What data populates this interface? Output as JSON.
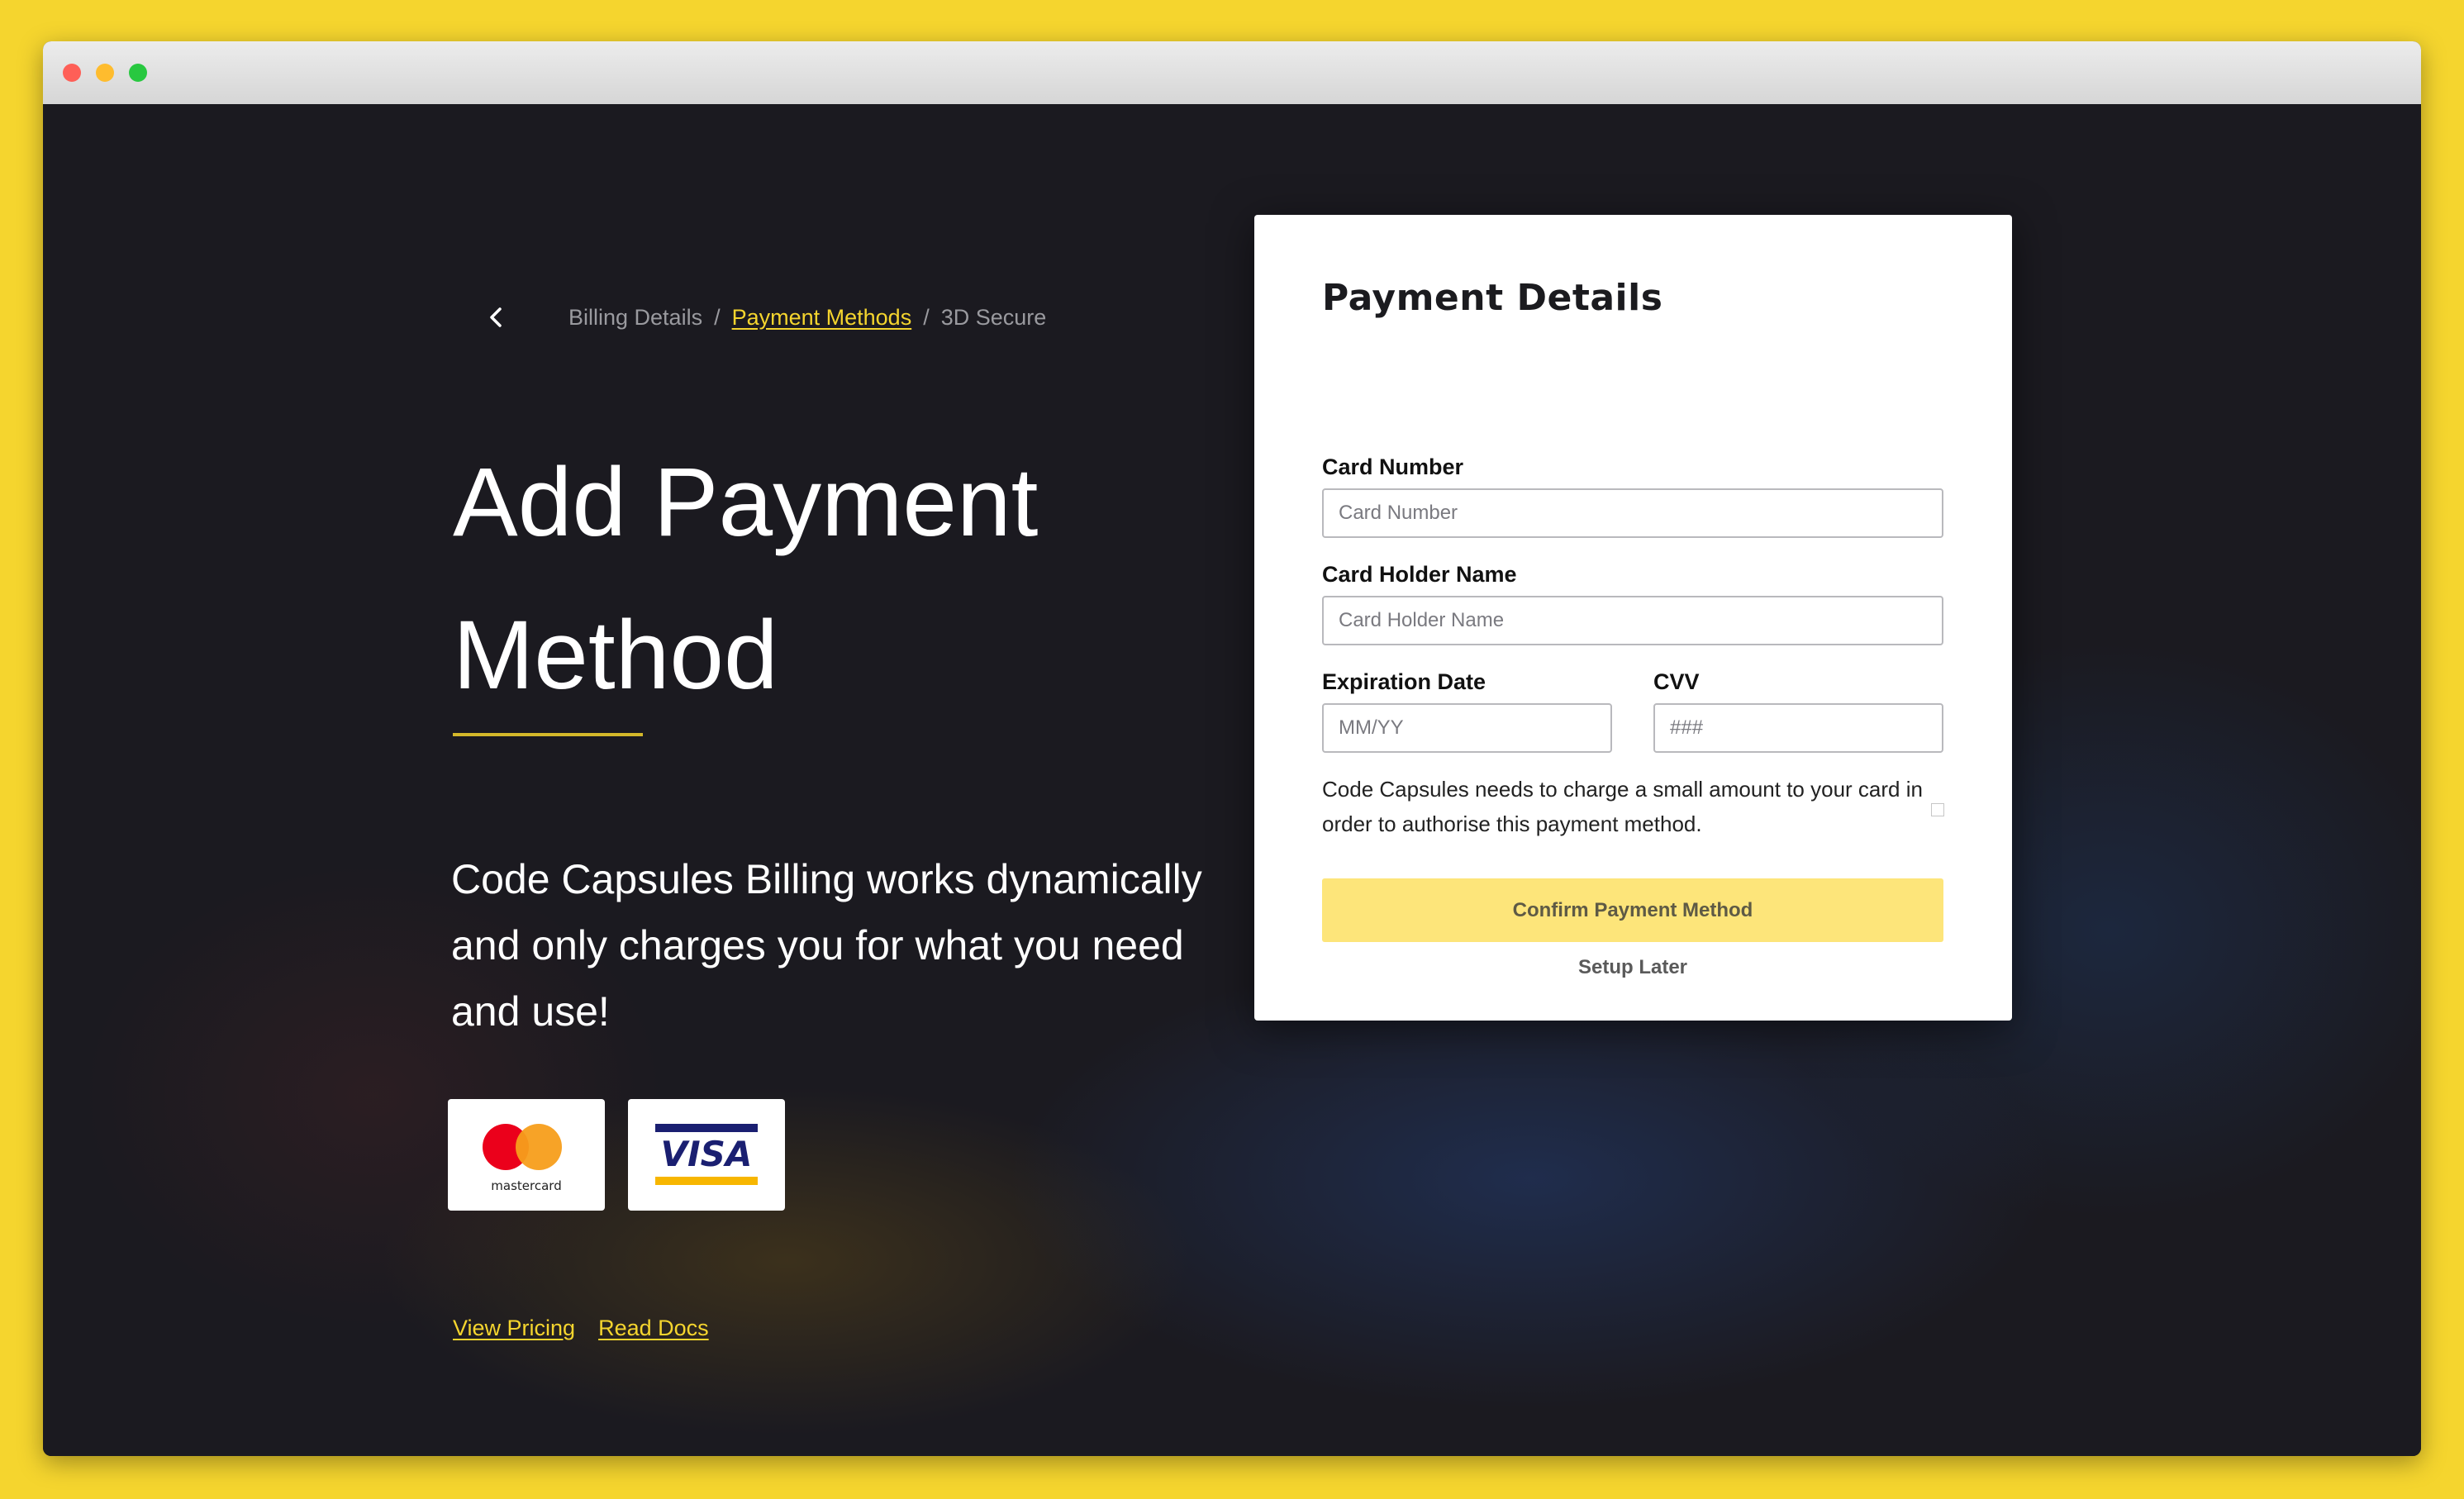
{
  "breadcrumb": {
    "back_icon": "chevron-left-icon",
    "items": [
      "Billing Details",
      "Payment Methods",
      "3D Secure"
    ],
    "separator": "/",
    "active_index": 1
  },
  "hero": {
    "title_line1": "Add Payment",
    "title_line2": "Method",
    "description": "Code Capsules Billing works dynamically and only charges you for what you need and use!",
    "accent_color": "#f5d52e"
  },
  "card_logos": {
    "mastercard_label": "mastercard",
    "visa_label": "VISA"
  },
  "links": {
    "view_pricing": "View Pricing",
    "read_docs": "Read Docs"
  },
  "form": {
    "title": "Payment Details",
    "card_number": {
      "label": "Card Number",
      "placeholder": "Card Number",
      "value": ""
    },
    "card_holder": {
      "label": "Card Holder Name",
      "placeholder": "Card Holder Name",
      "value": ""
    },
    "expiration": {
      "label": "Expiration Date",
      "placeholder": "MM/YY",
      "value": ""
    },
    "cvv": {
      "label": "CVV",
      "placeholder": "###",
      "value": ""
    },
    "note": "Code Capsules needs to charge a small amount to your card in order to authorise this payment method.",
    "confirm_label": "Confirm Payment Method",
    "setup_later_label": "Setup Later",
    "confirm_color": "#fde57a"
  }
}
